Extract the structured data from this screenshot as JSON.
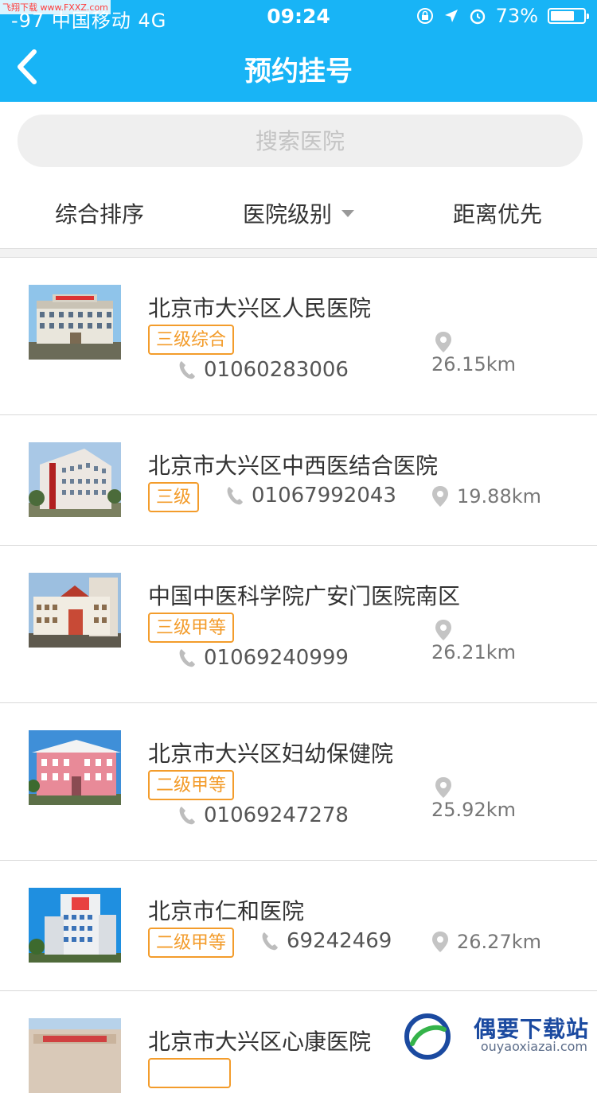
{
  "status_bar": {
    "carrier": "-97 中国移动  4G",
    "time": "09:24",
    "battery": "73%",
    "battery_level": 0.73,
    "icons": [
      "orientation-lock-icon",
      "location-arrow-icon",
      "alarm-icon",
      "battery-icon"
    ]
  },
  "nav": {
    "title": "预约挂号"
  },
  "search": {
    "placeholder": "搜索医院"
  },
  "filters": [
    {
      "label": "综合排序"
    },
    {
      "label": "医院级别"
    },
    {
      "label": "距离优先"
    }
  ],
  "hospitals": [
    {
      "name": "北京市大兴区人民医院",
      "level": "三级综合",
      "phone": "01060283006",
      "distance": "26.15km"
    },
    {
      "name": "北京市大兴区中西医结合医院",
      "level": "三级",
      "phone": "01067992043",
      "distance": "19.88km"
    },
    {
      "name": "中国中医科学院广安门医院南区",
      "level": "三级甲等",
      "phone": "01069240999",
      "distance": "26.21km"
    },
    {
      "name": "北京市大兴区妇幼保健院",
      "level": "二级甲等",
      "phone": "01069247278",
      "distance": "25.92km"
    },
    {
      "name": "北京市仁和医院",
      "level": "二级甲等",
      "phone": "69242469",
      "distance": "26.27km"
    },
    {
      "name": "北京市大兴区心康医院"
    }
  ],
  "watermark": {
    "title": "偶要下载站",
    "url": "ouyaoxiazai.com",
    "corner": "飞翔下载 www.FXXZ.com"
  },
  "colors": {
    "primary": "#18b4f6",
    "badge": "#f39c2b"
  }
}
